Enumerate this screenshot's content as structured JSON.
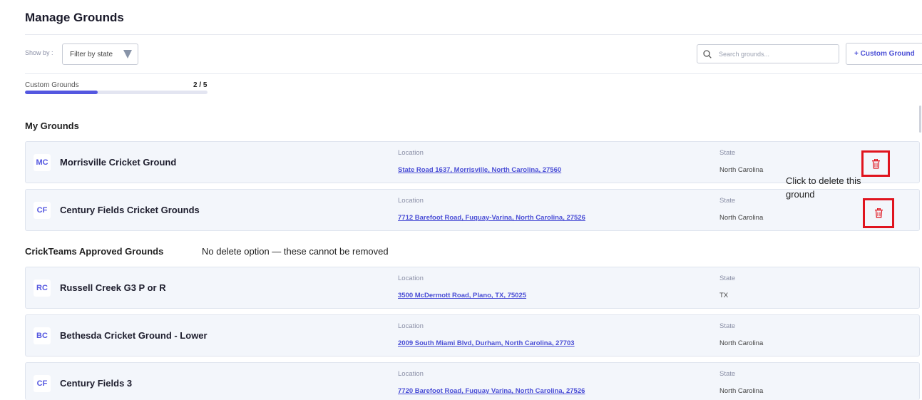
{
  "page": {
    "title": "Manage Grounds"
  },
  "toolbar": {
    "show_by_label": "Show by :",
    "filter_value": "Filter by state",
    "search_placeholder": "Search grounds...",
    "custom_ground_label": "+ Custom Ground"
  },
  "progress": {
    "label": "Custom Grounds",
    "count_text": "2 / 5",
    "used": 2,
    "total": 5
  },
  "my_grounds": {
    "title": "My Grounds",
    "items": [
      {
        "initials": "MC",
        "name": "Morrisville Cricket Ground",
        "location_label": "Location",
        "location": "State Road 1637, Morrisville, North Carolina, 27560",
        "state_label": "State",
        "state": "North Carolina"
      },
      {
        "initials": "CF",
        "name": "Century Fields Cricket Grounds",
        "location_label": "Location",
        "location": "7712 Barefoot Road, Fuquay-Varina, North Carolina, 27526",
        "state_label": "State",
        "state": "North Carolina"
      }
    ]
  },
  "annotation": {
    "delete_hint": "Click to delete this ground",
    "no_delete_note": "No delete option — these cannot be removed"
  },
  "approved": {
    "title": "CrickTeams Approved Grounds",
    "items": [
      {
        "initials": "RC",
        "name": "Russell Creek G3 P or R",
        "location_label": "Location",
        "location": "3500 McDermott Road, Plano, TX, 75025",
        "state_label": "State",
        "state": "TX"
      },
      {
        "initials": "BC",
        "name": "Bethesda Cricket Ground - Lower",
        "location_label": "Location",
        "location": "2009 South Miami Blvd, Durham, North Carolina, 27703",
        "state_label": "State",
        "state": "North Carolina"
      },
      {
        "initials": "CF",
        "name": "Century Fields 3",
        "location_label": "Location",
        "location": "7720 Barefoot Road, Fuquay Varina, North Carolina, 27526",
        "state_label": "State",
        "state": "North Carolina"
      }
    ]
  },
  "colors": {
    "accent": "#5457e0",
    "highlight": "#e0141e",
    "card_bg": "#f3f6fb"
  },
  "icons": {
    "search": "search-icon",
    "filter": "triangle-down-icon",
    "delete": "trash-icon"
  }
}
